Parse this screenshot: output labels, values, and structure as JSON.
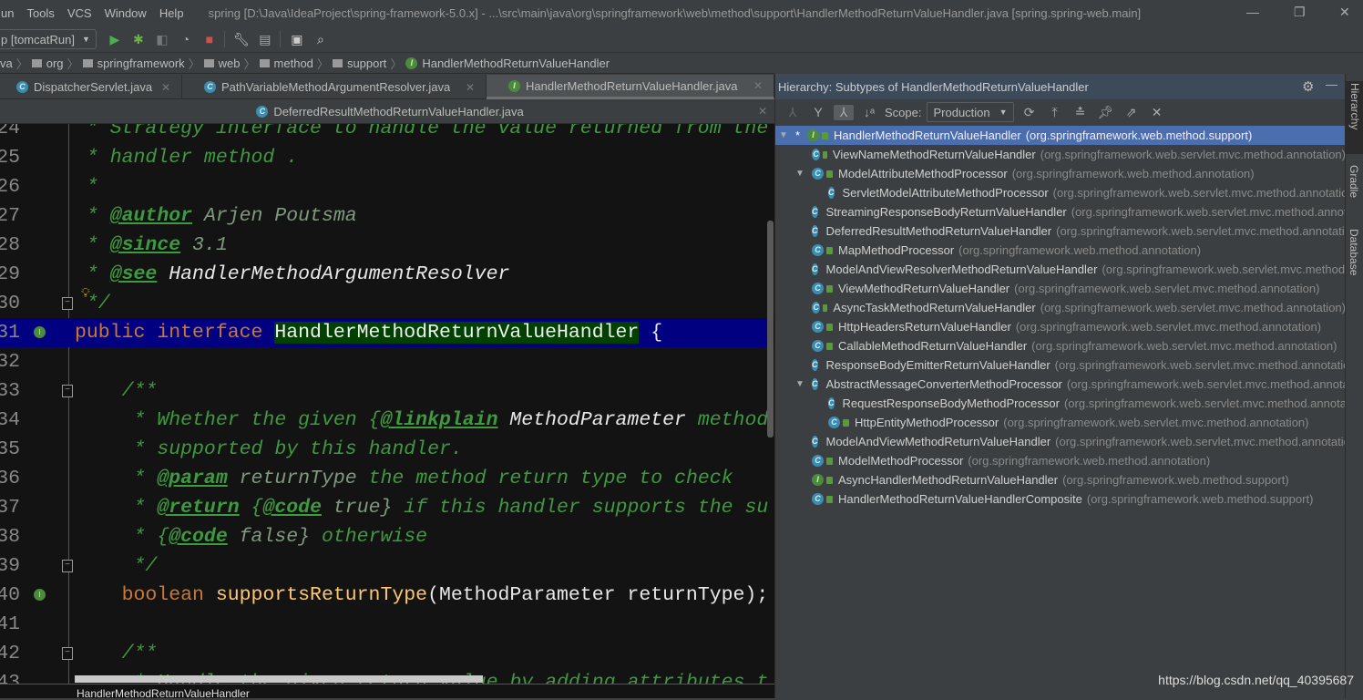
{
  "menu": {
    "items": [
      "un",
      "Tools",
      "VCS",
      "Window",
      "Help"
    ],
    "title": "spring [D:\\Java\\IdeaProject\\spring-framework-5.0.x] - ...\\src\\main\\java\\org\\springframework\\web\\method\\support\\HandlerMethodReturnValueHandler.java [spring.spring-web.main]"
  },
  "toolbar": {
    "run_config": "p [tomcatRun]",
    "icons": [
      "run-icon",
      "debug-icon",
      "coverage-icon",
      "profile-icon",
      "stop-icon",
      "settings-wrench-icon",
      "project-structure-icon",
      "terminal-icon",
      "search-icon"
    ]
  },
  "breadcrumb": [
    "va",
    "org",
    "springframework",
    "web",
    "method",
    "support",
    "HandlerMethodReturnValueHandler"
  ],
  "tabs_row1": [
    {
      "label": "DispatcherServlet.java",
      "icon": "C"
    },
    {
      "label": "PathVariableMethodArgumentResolver.java",
      "icon": "C"
    },
    {
      "label": "HandlerMethodReturnValueHandler.java",
      "icon": "I",
      "active": true
    }
  ],
  "tabs_row2": [
    {
      "label": "DeferredResultMethodReturnValueHandler.java",
      "icon": "C"
    }
  ],
  "code": [
    {
      "n": "24",
      "t": [
        [
          " * Strategy interface to handle the value returned from the",
          "cm"
        ]
      ]
    },
    {
      "n": "25",
      "t": [
        [
          " * handler method .",
          "cm"
        ]
      ]
    },
    {
      "n": "26",
      "t": [
        [
          " *",
          "cm"
        ]
      ]
    },
    {
      "n": "27",
      "t": [
        [
          " * ",
          "cm"
        ],
        [
          "@author",
          "tag"
        ],
        [
          " Arjen Poutsma",
          "val"
        ]
      ]
    },
    {
      "n": "28",
      "t": [
        [
          " * ",
          "cm"
        ],
        [
          "@since",
          "tag"
        ],
        [
          " 3.1",
          "val"
        ]
      ]
    },
    {
      "n": "29",
      "t": [
        [
          " * ",
          "cm"
        ],
        [
          "@see",
          "tag"
        ],
        [
          " HandlerMethodArgumentResolver",
          "ref"
        ]
      ]
    },
    {
      "n": "30",
      "t": [
        [
          " */",
          "cm"
        ]
      ]
    },
    {
      "n": "31",
      "t": [
        [
          "public interface ",
          "kw"
        ],
        [
          "HandlerMethodReturnValueHandler",
          "cls"
        ],
        [
          " {",
          "pl"
        ]
      ],
      "hl": true
    },
    {
      "n": "32",
      "t": []
    },
    {
      "n": "33",
      "t": [
        [
          "    /**",
          "cm"
        ]
      ]
    },
    {
      "n": "34",
      "t": [
        [
          "     * Whether the given {",
          "cm"
        ],
        [
          "@linkplain",
          "tag"
        ],
        [
          " MethodParameter",
          "ref"
        ],
        [
          " method",
          "cm"
        ]
      ]
    },
    {
      "n": "35",
      "t": [
        [
          "     * supported by this handler.",
          "cm"
        ]
      ]
    },
    {
      "n": "36",
      "t": [
        [
          "     * ",
          "cm"
        ],
        [
          "@param",
          "tag"
        ],
        [
          " returnType",
          "val"
        ],
        [
          " the method return type to check",
          "cm"
        ]
      ]
    },
    {
      "n": "37",
      "t": [
        [
          "     * ",
          "cm"
        ],
        [
          "@return",
          "tag"
        ],
        [
          " {",
          "cm"
        ],
        [
          "@code",
          "tag"
        ],
        [
          " true}",
          "val"
        ],
        [
          " if this handler supports the su",
          "cm"
        ]
      ]
    },
    {
      "n": "38",
      "t": [
        [
          "     * {",
          "cm"
        ],
        [
          "@code",
          "tag"
        ],
        [
          " false}",
          "val"
        ],
        [
          " otherwise",
          "cm"
        ]
      ]
    },
    {
      "n": "39",
      "t": [
        [
          "     */",
          "cm"
        ]
      ]
    },
    {
      "n": "40",
      "t": [
        [
          "    ",
          "pl"
        ],
        [
          "boolean ",
          "kw"
        ],
        [
          "supportsReturnType",
          "fn"
        ],
        [
          "(MethodParameter returnType);",
          "pl"
        ]
      ]
    },
    {
      "n": "41",
      "t": []
    },
    {
      "n": "42",
      "t": [
        [
          "    /**",
          "cm"
        ]
      ]
    },
    {
      "n": "43",
      "t": [
        [
          "     * Handle the given return value by adding attributes t",
          "cm"
        ]
      ]
    }
  ],
  "status_text": "HandlerMethodReturnValueHandler",
  "hierarchy": {
    "title": "Hierarchy:  Subtypes of HandlerMethodReturnValueHandler",
    "scope_label": "Scope:",
    "scope_value": "Production",
    "rows": [
      {
        "name": "HandlerMethodReturnValueHandler",
        "pkg": "(org.springframework.web.method.support)",
        "icon": "I",
        "level": 0,
        "expanded": true,
        "selected": true,
        "star": "*"
      },
      {
        "name": "ViewNameMethodReturnValueHandler",
        "pkg": "(org.springframework.web.servlet.mvc.method.annotation)",
        "icon": "C",
        "level": 1
      },
      {
        "name": "ModelAttributeMethodProcessor",
        "pkg": "(org.springframework.web.method.annotation)",
        "icon": "C",
        "level": 1,
        "expanded": true
      },
      {
        "name": "ServletModelAttributeMethodProcessor",
        "pkg": "(org.springframework.web.servlet.mvc.method.annotation)",
        "icon": "C",
        "level": 2
      },
      {
        "name": "StreamingResponseBodyReturnValueHandler",
        "pkg": "(org.springframework.web.servlet.mvc.method.annotation)",
        "icon": "C",
        "level": 1
      },
      {
        "name": "DeferredResultMethodReturnValueHandler",
        "pkg": "(org.springframework.web.servlet.mvc.method.annotation)",
        "icon": "C",
        "level": 1
      },
      {
        "name": "MapMethodProcessor",
        "pkg": "(org.springframework.web.method.annotation)",
        "icon": "C",
        "level": 1
      },
      {
        "name": "ModelAndViewResolverMethodReturnValueHandler",
        "pkg": "(org.springframework.web.servlet.mvc.method.annotation)",
        "icon": "C",
        "level": 1
      },
      {
        "name": "ViewMethodReturnValueHandler",
        "pkg": "(org.springframework.web.servlet.mvc.method.annotation)",
        "icon": "C",
        "level": 1
      },
      {
        "name": "AsyncTaskMethodReturnValueHandler",
        "pkg": "(org.springframework.web.servlet.mvc.method.annotation)",
        "icon": "C",
        "level": 1
      },
      {
        "name": "HttpHeadersReturnValueHandler",
        "pkg": "(org.springframework.web.servlet.mvc.method.annotation)",
        "icon": "C",
        "level": 1
      },
      {
        "name": "CallableMethodReturnValueHandler",
        "pkg": "(org.springframework.web.servlet.mvc.method.annotation)",
        "icon": "C",
        "level": 1
      },
      {
        "name": "ResponseBodyEmitterReturnValueHandler",
        "pkg": "(org.springframework.web.servlet.mvc.method.annotation)",
        "icon": "C",
        "level": 1
      },
      {
        "name": "AbstractMessageConverterMethodProcessor",
        "pkg": "(org.springframework.web.servlet.mvc.method.annotation)",
        "icon": "C",
        "level": 1,
        "expanded": true
      },
      {
        "name": "RequestResponseBodyMethodProcessor",
        "pkg": "(org.springframework.web.servlet.mvc.method.annotation)",
        "icon": "C",
        "level": 2
      },
      {
        "name": "HttpEntityMethodProcessor",
        "pkg": "(org.springframework.web.servlet.mvc.method.annotation)",
        "icon": "C",
        "level": 2
      },
      {
        "name": "ModelAndViewMethodReturnValueHandler",
        "pkg": "(org.springframework.web.servlet.mvc.method.annotation)",
        "icon": "C",
        "level": 1
      },
      {
        "name": "ModelMethodProcessor",
        "pkg": "(org.springframework.web.method.annotation)",
        "icon": "C",
        "level": 1
      },
      {
        "name": "AsyncHandlerMethodReturnValueHandler",
        "pkg": "(org.springframework.web.method.support)",
        "icon": "I",
        "level": 1
      },
      {
        "name": "HandlerMethodReturnValueHandlerComposite",
        "pkg": "(org.springframework.web.method.support)",
        "icon": "C",
        "level": 1
      }
    ]
  },
  "side_tabs": [
    "Hierarchy",
    "Gradle",
    "Database"
  ],
  "watermark": "https://blog.csdn.net/qq_40395687"
}
